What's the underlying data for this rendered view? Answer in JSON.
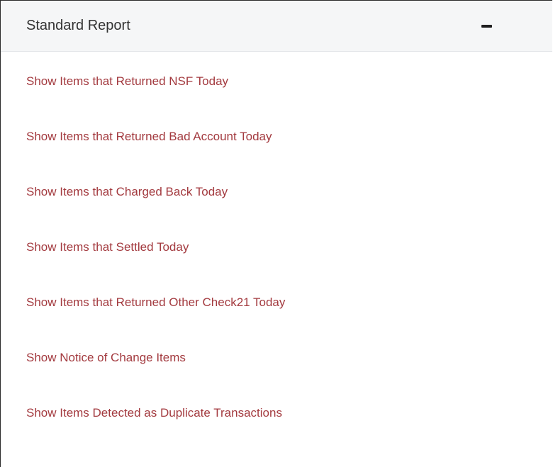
{
  "panel": {
    "title": "Standard Report",
    "collapse_icon": "minus-icon"
  },
  "links": [
    {
      "label": "Show Items that Returned NSF Today"
    },
    {
      "label": "Show Items that Returned Bad Account Today"
    },
    {
      "label": "Show Items that Charged Back Today"
    },
    {
      "label": "Show Items that Settled Today"
    },
    {
      "label": "Show Items that Returned Other Check21 Today"
    },
    {
      "label": "Show Notice of Change Items"
    },
    {
      "label": "Show Items Detected as Duplicate Transactions"
    }
  ],
  "colors": {
    "link": "#a33a3f",
    "header_bg": "#f5f6f7",
    "title": "#333333"
  }
}
